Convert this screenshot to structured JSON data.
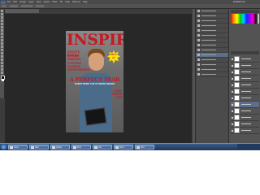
{
  "app": {
    "menu": [
      "File",
      "Edit",
      "Image",
      "Layer",
      "Type",
      "Select",
      "Filter",
      "3D",
      "View",
      "Window",
      "Help"
    ],
    "workspace_label": "ESSENTIALS",
    "document_tab": "",
    "status": ""
  },
  "magazine": {
    "masthead": "INSPIRE",
    "left_cover_lines": [
      "ATHLETE PROFILE",
      "BECOME",
      "GREATER",
      "STUDYING",
      "ADVANCE",
      "OPPORTUNITIES"
    ],
    "burst_text": "ONLY\n£2",
    "headline": "A PERFECT YEAR",
    "subline": "EVERYTHING THE STUDENT NEEDS",
    "right_cover_lines": [
      "EXAM",
      "STRESS",
      "TIPS"
    ],
    "colors": {
      "masthead": "#c21a24",
      "burst": "#ffe400"
    }
  },
  "panels": {
    "adjustments_rows": 14,
    "layers_count": 12
  },
  "taskbar": {
    "buttons": [
      "Inbox",
      "Mail",
      "Adobe",
      "Phot",
      "Doc",
      "Wind",
      "Fold"
    ],
    "clock": ""
  }
}
